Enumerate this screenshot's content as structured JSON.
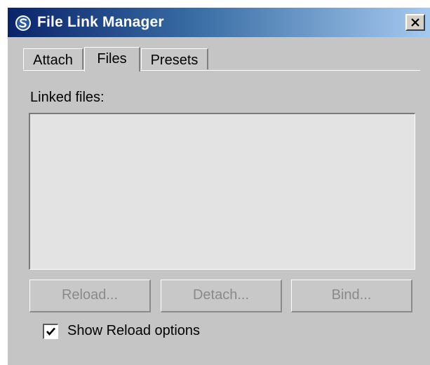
{
  "window": {
    "title": "File Link Manager",
    "close_label": "X"
  },
  "tabs": [
    {
      "label": "Attach",
      "active": false
    },
    {
      "label": "Files",
      "active": true
    },
    {
      "label": "Presets",
      "active": false
    }
  ],
  "files_panel": {
    "linked_files_label": "Linked files:",
    "linked_files": [],
    "buttons": {
      "reload": "Reload...",
      "detach": "Detach...",
      "bind": "Bind..."
    },
    "show_reload_options": {
      "label": "Show Reload options",
      "checked": true
    }
  },
  "colors": {
    "titlebar_start": "#0a246a",
    "titlebar_end": "#a6caf0",
    "panel_bg": "#c5c5c5",
    "list_bg": "#e3e3e3",
    "disabled_text": "#8a8a8a"
  },
  "icons": {
    "app": "app-logo-icon",
    "close": "close-icon",
    "check": "checkmark-icon"
  }
}
